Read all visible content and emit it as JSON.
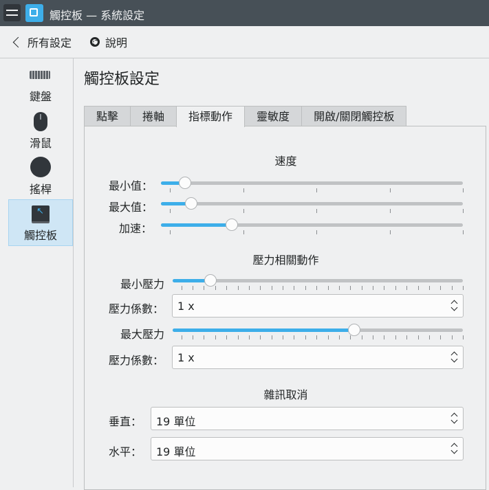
{
  "window": {
    "title": "觸控板 — 系統設定"
  },
  "toolbar": {
    "back_label": "所有設定",
    "help_label": "說明"
  },
  "sidebar": {
    "items": [
      {
        "label": "鍵盤",
        "icon": "keyboard-icon"
      },
      {
        "label": "滑鼠",
        "icon": "mouse-icon"
      },
      {
        "label": "搖桿",
        "icon": "joystick-icon"
      },
      {
        "label": "觸控板",
        "icon": "touchpad-icon",
        "selected": true
      }
    ]
  },
  "page": {
    "title": "觸控板設定"
  },
  "tabs": [
    "點擊",
    "捲軸",
    "指標動作",
    "靈敏度",
    "開啟/關閉觸控板"
  ],
  "active_tab": "指標動作",
  "speed": {
    "heading": "速度",
    "min_label": "最小值：",
    "min_value": 0.08,
    "max_label": "最大值：",
    "max_value": 0.1,
    "accel_label": "加速：",
    "accel_value": 0.235
  },
  "pressure": {
    "heading": "壓力相關動作",
    "min_label": "最小壓力",
    "min_value": 0.13,
    "factor1_label": "壓力係數：",
    "factor1_value": "1 x",
    "max_label": "最大壓力",
    "max_value": 0.625,
    "factor2_label": "壓力係數：",
    "factor2_value": "1 x"
  },
  "noise": {
    "heading": "雜訊取消",
    "vertical_label": "垂直：",
    "vertical_value": "19 單位",
    "horizontal_label": "水平：",
    "horizontal_value": "19 單位"
  },
  "colors": {
    "accent": "#3daee9",
    "titlebar": "#475057",
    "selection": "#cfe6f5"
  }
}
